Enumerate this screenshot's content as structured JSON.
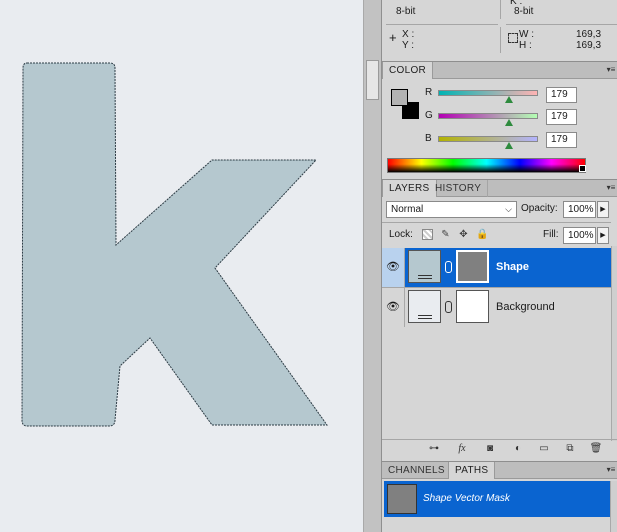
{
  "info": {
    "k_label": "K :",
    "left_bit": "8-bit",
    "right_bit": "8-bit",
    "x_label": "X :",
    "y_label": "Y :",
    "w_label": "W :",
    "h_label": "H :",
    "w_value": "169,3",
    "h_value": "169,3"
  },
  "color": {
    "tab": "COLOR",
    "r_label": "R",
    "g_label": "G",
    "b_label": "B",
    "r_value": "179",
    "g_value": "179",
    "b_value": "179",
    "foreground": "#b3b3b3",
    "background": "#000000"
  },
  "layers": {
    "tabs": [
      "LAYERS",
      "HISTORY"
    ],
    "blend_mode": "Normal",
    "opacity_label": "Opacity:",
    "opacity_value": "100%",
    "lock_label": "Lock:",
    "fill_label": "Fill:",
    "fill_value": "100%",
    "items": [
      {
        "name": "Shape",
        "selected": true
      },
      {
        "name": "Background",
        "selected": false
      }
    ]
  },
  "paths": {
    "tabs": [
      "CHANNELS",
      "PATHS"
    ],
    "items": [
      {
        "name": "Shape Vector Mask"
      }
    ]
  },
  "canvas": {
    "shape_fill": "#b5c8cf",
    "background": "#e9ecf0"
  }
}
